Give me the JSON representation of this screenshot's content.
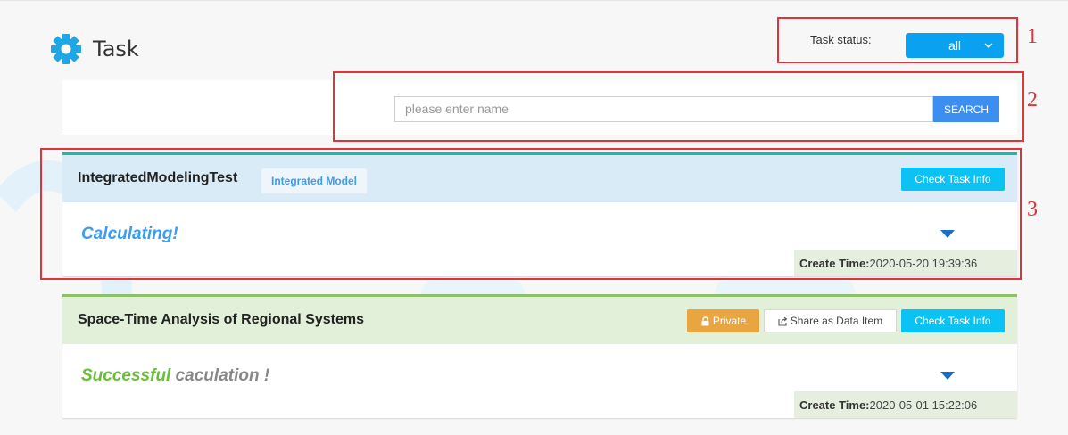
{
  "header": {
    "title": "Task",
    "icon": "gear-icon"
  },
  "filter": {
    "label": "Task status:",
    "value": "all"
  },
  "search": {
    "placeholder": "please enter name",
    "button": "SEARCH"
  },
  "tasks": [
    {
      "name": "IntegratedModelingTest",
      "tag": "Integrated Model",
      "state_text": "Calculating!",
      "check_button": "Check Task Info",
      "create_time_label": "Create Time:",
      "create_time": "2020-05-20 19:39:36"
    },
    {
      "name": "Space-Time Analysis of Regional Systems",
      "private_button": "Private",
      "share_button": "Share as Data Item",
      "check_button": "Check Task Info",
      "state_success": "Successful",
      "state_rest": " caculation !",
      "create_time_label": "Create Time:",
      "create_time": "2020-05-01 15:22:06"
    }
  ],
  "annotations": [
    "1",
    "2",
    "3"
  ],
  "colors": {
    "accent": "#0aa2f0",
    "private": "#e8a540",
    "success": "#68be38",
    "annotation": "#e0333a"
  }
}
